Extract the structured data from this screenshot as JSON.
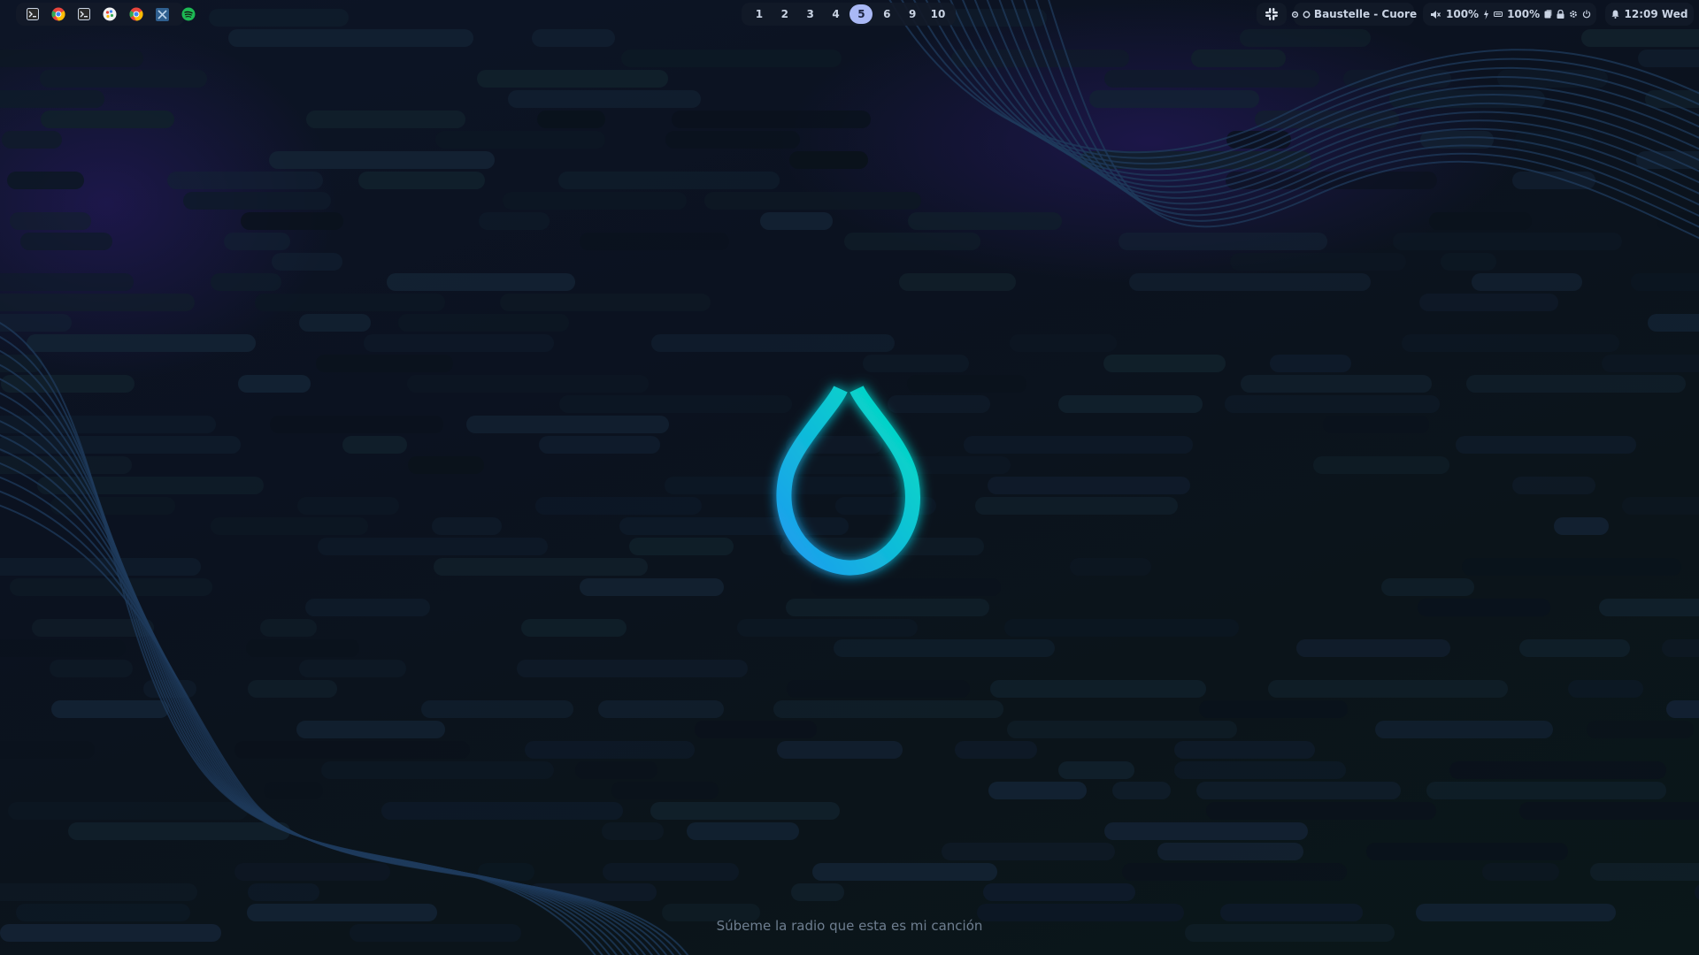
{
  "launcher": {
    "apps": [
      {
        "name": "terminal-icon",
        "color": "#d8dee9"
      },
      {
        "name": "chrome-icon",
        "color": "#e8453c"
      },
      {
        "name": "terminal-icon",
        "color": "#d8dee9"
      },
      {
        "name": "colorpicker-icon",
        "color": "#f0f0f0"
      },
      {
        "name": "chrome-icon",
        "color": "#e8453c"
      },
      {
        "name": "vscode-icon",
        "color": "#3d7fc8"
      },
      {
        "name": "spotify-icon",
        "color": "#1db954"
      }
    ]
  },
  "workspaces": {
    "items": [
      "1",
      "2",
      "3",
      "4",
      "5",
      "6",
      "9",
      "10"
    ],
    "active": "5"
  },
  "music": {
    "track": "Baustelle - Cuore"
  },
  "system": {
    "volume": "100%",
    "brightness": "100%"
  },
  "clock": {
    "time": "12:09 Wed"
  },
  "lockscreen": {
    "song_line": "Súbeme la radio que esta es mi canción"
  },
  "colors": {
    "accent_active_workspace": "#a9b8f5",
    "logo_gradient_start": "#1e9bf0",
    "logo_gradient_end": "#00e0c0"
  }
}
